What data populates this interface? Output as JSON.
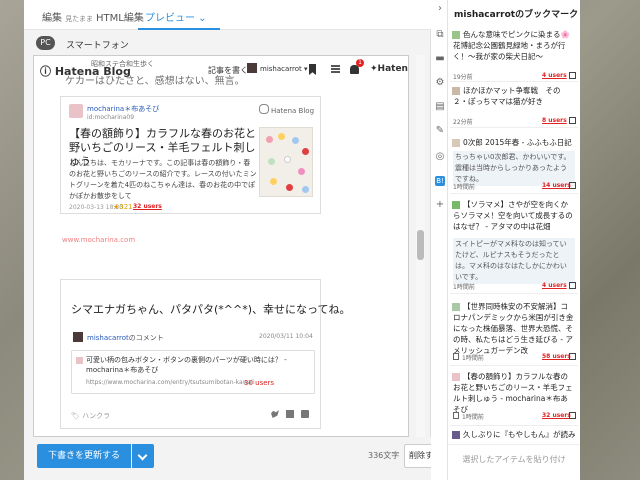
{
  "tabs": {
    "edit": "編集",
    "edit_sub": "見たまま",
    "html": "HTML編集",
    "preview": "プレビュー"
  },
  "device": {
    "pc": "PC",
    "sp": "スマートフォン"
  },
  "hatena_bar": {
    "logo": "Hatena Blog",
    "ghost_small": "昭和ステ合和生歩く",
    "ghost_large": "ケカーはひたさと、感想はない、無言。",
    "write": "記事を書く",
    "user": "mishacarrot",
    "badge_count": "1",
    "hatena": "Hatena"
  },
  "card1": {
    "author": "mocharina＊布あそび",
    "id": "id:mocharina09",
    "blog_label": "Hatena Blog",
    "title": "【春の額飾り】カラフルな春のお花と野いちごのリース・羊毛フェルト刺しゅう",
    "desc": "こんにちは、モカリーナです。この記事は春の額飾り・春のお花と野いちごのリースの紹介です。レースの付いたミントグリーンを着た4匹のねこちゃん達は、春のお花の中でぽかぽかお散歩をして",
    "date": "2020-03-13 18:30",
    "stars": "★321",
    "users": "32 users"
  },
  "url_line": "www.mocharina.com",
  "card2": {
    "title": "シマエナガちゃん、パタパタ(*^^*)、幸せになってね。",
    "user": "mishacarrot",
    "user_suffix": "のコメント",
    "time": "2020/03/11 10:04",
    "quote_title": "可愛い柄の包みボタン・ボタンの裏側のパーツが硬い時には？ - mocharina＊布あそび",
    "quote_url": "https://www.mocharina.com/entry/tsutsumibotan-kawaii",
    "quote_users": "30 users",
    "hangura": "ハンクラ"
  },
  "bottom": {
    "update": "下書きを更新する",
    "chars": "336文字",
    "delete": "削除する"
  },
  "side_icons": [
    "collapse-arrow",
    "copy-icon",
    "folder-icon",
    "gear-icon",
    "document-icon",
    "twitter-icon",
    "instagram-icon",
    "hatena-b-icon",
    "plus-icon"
  ],
  "bookmarks": {
    "title": "mishacarrotのブックマーク",
    "items": [
      {
        "title": "色んな意味でピンクに染まる🌸花博記念公園鶴見緑地・まろが行く！〜我が家の柴犬日記〜",
        "time": "19分前",
        "users": "4 users",
        "comment": ""
      },
      {
        "title": "ほかほかマット争奪戦　その２・ぽっちママは猫が好き",
        "time": "22分前",
        "users": "8 users",
        "comment": ""
      },
      {
        "title": "0次郎 2015年春 - ふふもふ日記",
        "time": "1時間前",
        "users": "14 users",
        "comment": "ちっちゃい0次郎君、かわいいです。震種は当時からしっかりあったようですね。"
      },
      {
        "title": "【ソラマメ】さやが空を向くからソラマメ！空を向いて成長するのはなぜ？ - アタマの中は花畑",
        "time": "1時間前",
        "users": "4 users",
        "comment": "スイトピーがマメ科なのは知っていたけど、ルピナスもそうだったとは。マメ科のはなはたしかにかわいいです。"
      },
      {
        "title": "【世界同時株安の不安解消】コロナパンデミックから米国が引き金になった株価暴落、世界大恐慌、その時、私たちはどう生き延びる - アメリッシュガーデン改",
        "time": "1時間前",
        "users": "58 users",
        "comment": ""
      },
      {
        "title": "【春の額飾り】カラフルな春のお花と野いちごのリース・羊毛フェルト刺しゅう - mocharina＊布あそび",
        "time": "1時間前",
        "users": "32 users",
        "comment": ""
      },
      {
        "title": "久しぶりに『もやしもん』が読みたくな",
        "time": "",
        "users": "",
        "comment": ""
      }
    ],
    "paste": "選択したアイテムを貼り付け"
  },
  "colors": {
    "accent": "#2a8fde",
    "users_red": "#e02222"
  }
}
